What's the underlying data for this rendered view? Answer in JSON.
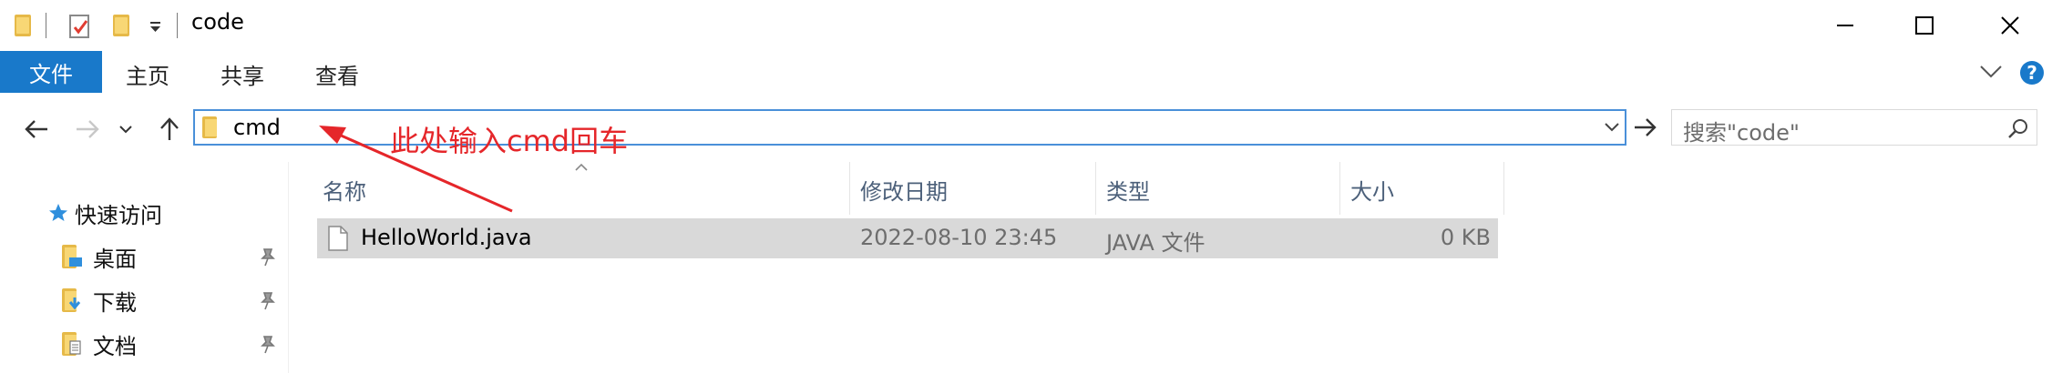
{
  "window": {
    "title": "code"
  },
  "ribbon": {
    "file_tab": "文件",
    "tabs": [
      "主页",
      "共享",
      "查看"
    ]
  },
  "address_bar": {
    "value": "cmd"
  },
  "search": {
    "placeholder": "搜索\"code\""
  },
  "annotation": {
    "text": "此处输入cmd回车",
    "color": "#e5262a"
  },
  "nav_pane": {
    "quick_access": "快速访问",
    "items": [
      {
        "label": "桌面",
        "icon": "desktop-folder-icon",
        "pinned": true
      },
      {
        "label": "下载",
        "icon": "downloads-folder-icon",
        "pinned": true
      },
      {
        "label": "文档",
        "icon": "documents-folder-icon",
        "pinned": true
      }
    ]
  },
  "file_list": {
    "columns": [
      "名称",
      "修改日期",
      "类型",
      "大小"
    ],
    "rows": [
      {
        "name": "HelloWorld.java",
        "modified": "2022-08-10 23:45",
        "type": "JAVA 文件",
        "size": "0 KB"
      }
    ]
  },
  "colors": {
    "accent": "#1979ca",
    "address_border": "#4a90d9",
    "selected_row": "#d9d9d9"
  }
}
